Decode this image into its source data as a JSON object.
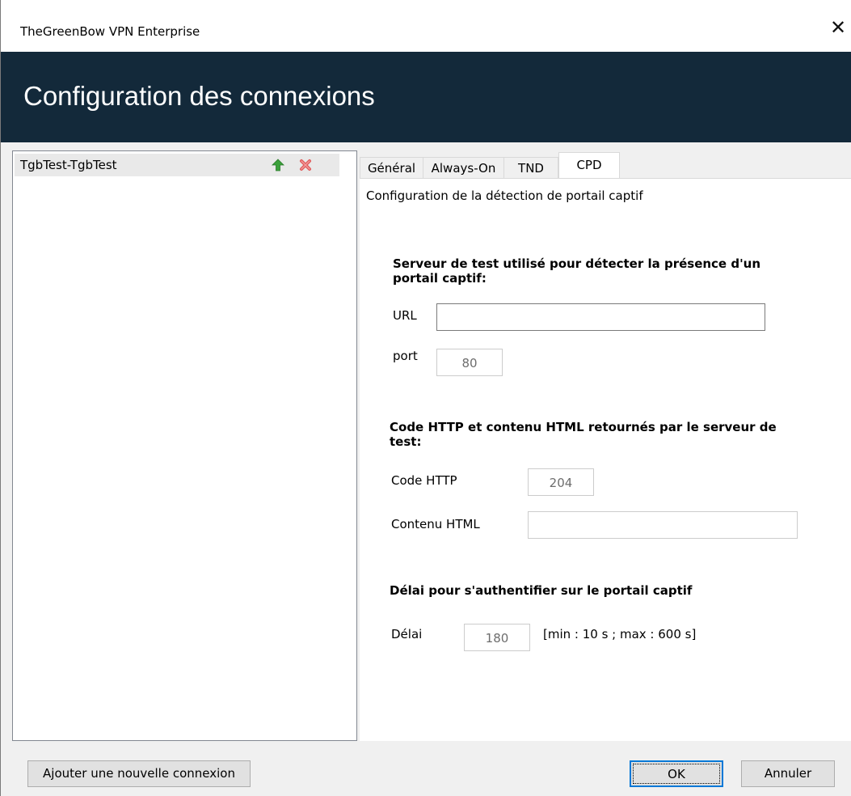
{
  "window": {
    "title": "TheGreenBow VPN Enterprise",
    "close_glyph": "✕"
  },
  "banner": {
    "heading": "Configuration des connexions"
  },
  "connections": {
    "items": [
      {
        "label": "TgbTest-TgbTest",
        "icons": [
          "arrow-up-icon",
          "delete-x-icon"
        ]
      }
    ]
  },
  "tabs": [
    {
      "label": "Général",
      "active": false
    },
    {
      "label": "Always-On",
      "active": false
    },
    {
      "label": "TND",
      "active": false
    },
    {
      "label": "CPD",
      "active": true
    }
  ],
  "cpd": {
    "subtitle": "Configuration de la détection de portail captif",
    "server_section": {
      "title_line1": "Serveur de test utilisé pour détecter la présence d'un",
      "title_line2": "portail captif:",
      "url_label": "URL",
      "url_value": "",
      "port_label": "port",
      "port_value": "80"
    },
    "http_section": {
      "title_line1": "Code HTTP et contenu HTML retournés par le serveur de",
      "title_line2": "test:",
      "code_label": "Code HTTP",
      "code_value": "204",
      "content_label": "Contenu HTML",
      "content_value": ""
    },
    "delay_section": {
      "title": "Délai pour s'authentifier sur le portail captif",
      "delay_label": "Délai",
      "delay_value": "180",
      "delay_hint": "[min : 10 s ; max : 600 s]"
    }
  },
  "footer": {
    "add_label": "Ajouter une nouvelle connexion",
    "ok_label": "OK",
    "cancel_label": "Annuler"
  },
  "colors": {
    "banner_bg": "#13293a",
    "arrow_green": "#3aa13a",
    "delete_red": "#e05a5a",
    "focus_blue": "#0078d7"
  }
}
